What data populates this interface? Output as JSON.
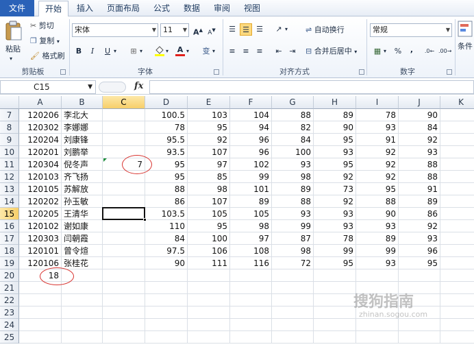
{
  "tabs": [
    {
      "label": "文件"
    },
    {
      "label": "开始"
    },
    {
      "label": "插入"
    },
    {
      "label": "页面布局"
    },
    {
      "label": "公式"
    },
    {
      "label": "数据"
    },
    {
      "label": "审阅"
    },
    {
      "label": "视图"
    }
  ],
  "ribbon": {
    "clipboard": {
      "paste": "粘贴",
      "cut": "剪切",
      "copy": "复制",
      "format_painter": "格式刷",
      "label": "剪贴板"
    },
    "font": {
      "name": "宋体",
      "size": "11",
      "bold": "B",
      "italic": "I",
      "underline": "U",
      "grow": "A",
      "shrink": "A",
      "label": "字体",
      "font_color_letter": "A",
      "phonetic": "变"
    },
    "alignment": {
      "wrap": "自动换行",
      "merge": "合并后居中",
      "label": "对齐方式"
    },
    "number": {
      "format": "常规",
      "percent": "%",
      "comma": ",",
      "label": "数字"
    },
    "styles": {
      "conditional": "条件"
    }
  },
  "formula_bar": {
    "name_box": "C15",
    "fx": "fx",
    "formula": ""
  },
  "columns": [
    "A",
    "B",
    "C",
    "D",
    "E",
    "F",
    "G",
    "H",
    "I",
    "J",
    "K"
  ],
  "selected": {
    "column": "C",
    "row": "15"
  },
  "rows": [
    {
      "row": "7",
      "A": "120206",
      "B": "李北大",
      "C": "",
      "D": "100.5",
      "E": "103",
      "F": "104",
      "G": "88",
      "H": "89",
      "I": "78",
      "J": "90"
    },
    {
      "row": "8",
      "A": "120302",
      "B": "李娜娜",
      "C": "",
      "D": "78",
      "E": "95",
      "F": "94",
      "G": "82",
      "H": "90",
      "I": "93",
      "J": "84"
    },
    {
      "row": "9",
      "A": "120204",
      "B": "刘康锋",
      "C": "",
      "D": "95.5",
      "E": "92",
      "F": "96",
      "G": "84",
      "H": "95",
      "I": "91",
      "J": "92"
    },
    {
      "row": "10",
      "A": "120201",
      "B": "刘鹏举",
      "C": "",
      "D": "93.5",
      "E": "107",
      "F": "96",
      "G": "100",
      "H": "93",
      "I": "92",
      "J": "93"
    },
    {
      "row": "11",
      "A": "120304",
      "B": "倪冬声",
      "C": "7",
      "D": "95",
      "E": "97",
      "F": "102",
      "G": "93",
      "H": "95",
      "I": "92",
      "J": "88"
    },
    {
      "row": "12",
      "A": "120103",
      "B": "齐飞扬",
      "C": "",
      "D": "95",
      "E": "85",
      "F": "99",
      "G": "98",
      "H": "92",
      "I": "92",
      "J": "88"
    },
    {
      "row": "13",
      "A": "120105",
      "B": "苏解放",
      "C": "",
      "D": "88",
      "E": "98",
      "F": "101",
      "G": "89",
      "H": "73",
      "I": "95",
      "J": "91"
    },
    {
      "row": "14",
      "A": "120202",
      "B": "孙玉敏",
      "C": "",
      "D": "86",
      "E": "107",
      "F": "89",
      "G": "88",
      "H": "92",
      "I": "88",
      "J": "89"
    },
    {
      "row": "15",
      "A": "120205",
      "B": "王清华",
      "C": "",
      "D": "103.5",
      "E": "105",
      "F": "105",
      "G": "93",
      "H": "93",
      "I": "90",
      "J": "86"
    },
    {
      "row": "16",
      "A": "120102",
      "B": "谢如康",
      "C": "",
      "D": "110",
      "E": "95",
      "F": "98",
      "G": "99",
      "H": "93",
      "I": "93",
      "J": "92"
    },
    {
      "row": "17",
      "A": "120303",
      "B": "闫朝霞",
      "C": "",
      "D": "84",
      "E": "100",
      "F": "97",
      "G": "87",
      "H": "78",
      "I": "89",
      "J": "93"
    },
    {
      "row": "18",
      "A": "120101",
      "B": "曾令煊",
      "C": "",
      "D": "97.5",
      "E": "106",
      "F": "108",
      "G": "98",
      "H": "99",
      "I": "99",
      "J": "96"
    },
    {
      "row": "19",
      "A": "120106",
      "B": "张桂花",
      "C": "",
      "D": "90",
      "E": "111",
      "F": "116",
      "G": "72",
      "H": "95",
      "I": "93",
      "J": "95"
    },
    {
      "row": "20",
      "A": "18",
      "B": "",
      "C": "",
      "D": "",
      "E": "",
      "F": "",
      "G": "",
      "H": "",
      "I": "",
      "J": ""
    },
    {
      "row": "21",
      "A": "",
      "B": "",
      "C": "",
      "D": "",
      "E": "",
      "F": "",
      "G": "",
      "H": "",
      "I": "",
      "J": ""
    },
    {
      "row": "22",
      "A": "",
      "B": "",
      "C": "",
      "D": "",
      "E": "",
      "F": "",
      "G": "",
      "H": "",
      "I": "",
      "J": ""
    },
    {
      "row": "23",
      "A": "",
      "B": "",
      "C": "",
      "D": "",
      "E": "",
      "F": "",
      "G": "",
      "H": "",
      "I": "",
      "J": ""
    },
    {
      "row": "24",
      "A": "",
      "B": "",
      "C": "",
      "D": "",
      "E": "",
      "F": "",
      "G": "",
      "H": "",
      "I": "",
      "J": ""
    },
    {
      "row": "25",
      "A": "",
      "B": "",
      "C": "",
      "D": "",
      "E": "",
      "F": "",
      "G": "",
      "H": "",
      "I": "",
      "J": ""
    }
  ],
  "watermark": {
    "text": "搜狗指南",
    "sub": "zhinan.sogou.com"
  },
  "colors": {
    "accent": "#2a62b8",
    "highlight": "#f7cf6a",
    "annotation": "#d8322e"
  }
}
